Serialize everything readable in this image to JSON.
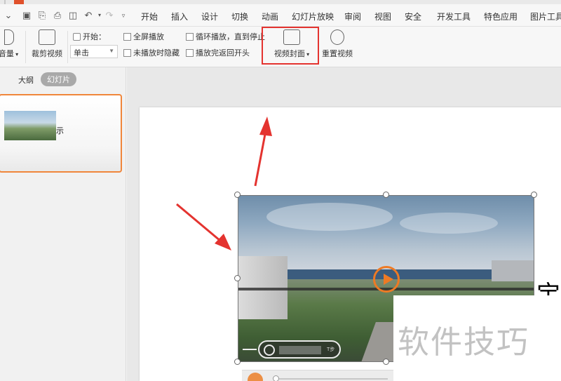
{
  "menu": {
    "tabs": [
      "开始",
      "插入",
      "设计",
      "切换",
      "动画",
      "幻灯片放映",
      "审阅",
      "视图",
      "安全",
      "开发工具",
      "特色应用",
      "图片工具"
    ]
  },
  "ribbon": {
    "volume_label": "音量",
    "trim_label": "裁剪视频",
    "start_label": "开始：",
    "start_value": "单击",
    "checkboxes": {
      "fullscreen": "全屏播放",
      "hide_when_not_playing": "未播放时隐藏",
      "loop": "循环播放，直到停止",
      "rewind": "播放完返回开头"
    },
    "cover_label": "视频封面",
    "reset_label": "重置视频"
  },
  "left_panel": {
    "outline_tab": "大纲",
    "slides_tab": "幻灯片",
    "thumb_title": "示"
  },
  "slide": {
    "title_fragment": "宝"
  },
  "video": {
    "overlay_text": "T步"
  },
  "watermark": {
    "text": "软件技巧"
  },
  "colors": {
    "accent_orange": "#ee7a24",
    "highlight_red": "#e4332f",
    "thumb_border": "#f0863b"
  }
}
